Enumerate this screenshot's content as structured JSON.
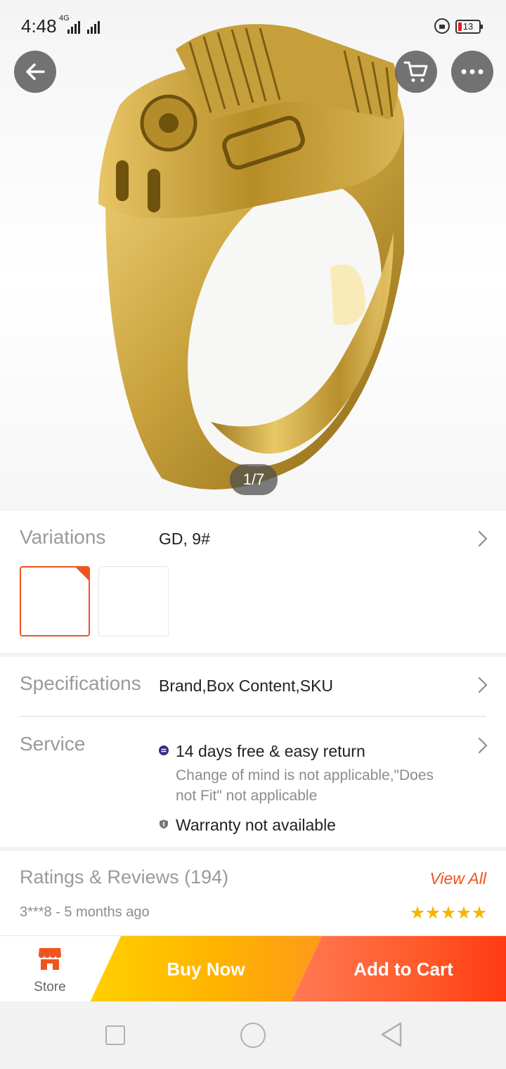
{
  "status_bar": {
    "time": "4:48",
    "network": "4G",
    "battery": "13"
  },
  "image": {
    "counter": "1/7"
  },
  "variations": {
    "label": "Variations",
    "value": "GD, 9#"
  },
  "specifications": {
    "label": "Specifications",
    "value": "Brand,Box Content,SKU"
  },
  "service": {
    "label": "Service",
    "return_title": "14 days free & easy return",
    "return_note": "Change of mind is not applicable,\"Does not Fit\" not applicable",
    "warranty": "Warranty not available"
  },
  "ratings": {
    "title": "Ratings & Reviews (194)",
    "view_all": "View All",
    "reviewer": "3***8 - 5 months ago",
    "stars": 5
  },
  "actions": {
    "store": "Store",
    "buy_now": "Buy Now",
    "add_to_cart": "Add to Cart"
  },
  "colors": {
    "accent": "#f0541e",
    "buy_now": "#ffc300",
    "add_to_cart": "#ff5a2a"
  }
}
